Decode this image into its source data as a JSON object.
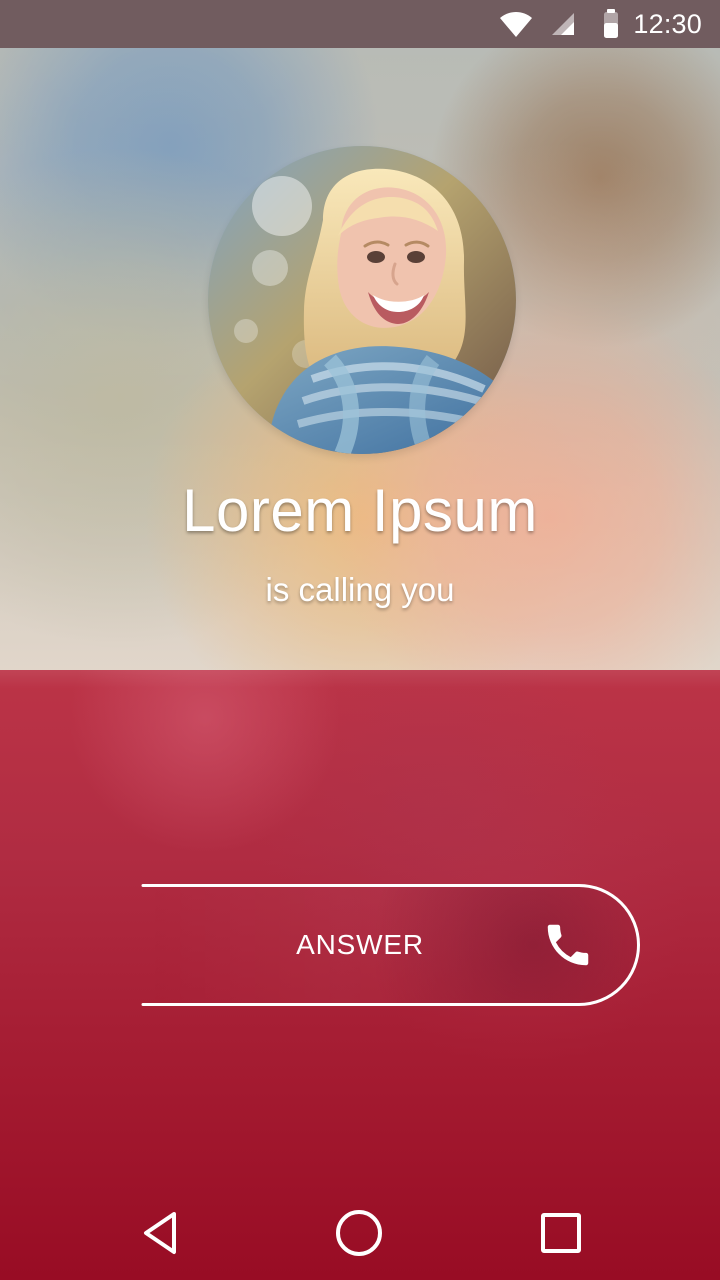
{
  "status_bar": {
    "time": "12:30",
    "icons": [
      "wifi-icon",
      "signal-icon",
      "battery-icon"
    ]
  },
  "caller": {
    "name": "Lorem Ipsum",
    "status": "is calling you",
    "avatar": "caller-photo"
  },
  "answer": {
    "label": "ANSWER",
    "icon": "phone-icon"
  },
  "navigation": {
    "buttons": [
      "back-icon",
      "home-icon",
      "recents-icon"
    ]
  },
  "colors": {
    "panel_top": "#bc3447",
    "panel_bottom": "#980c24",
    "text": "#ffffff",
    "status_bar": "#6e6e6e"
  }
}
